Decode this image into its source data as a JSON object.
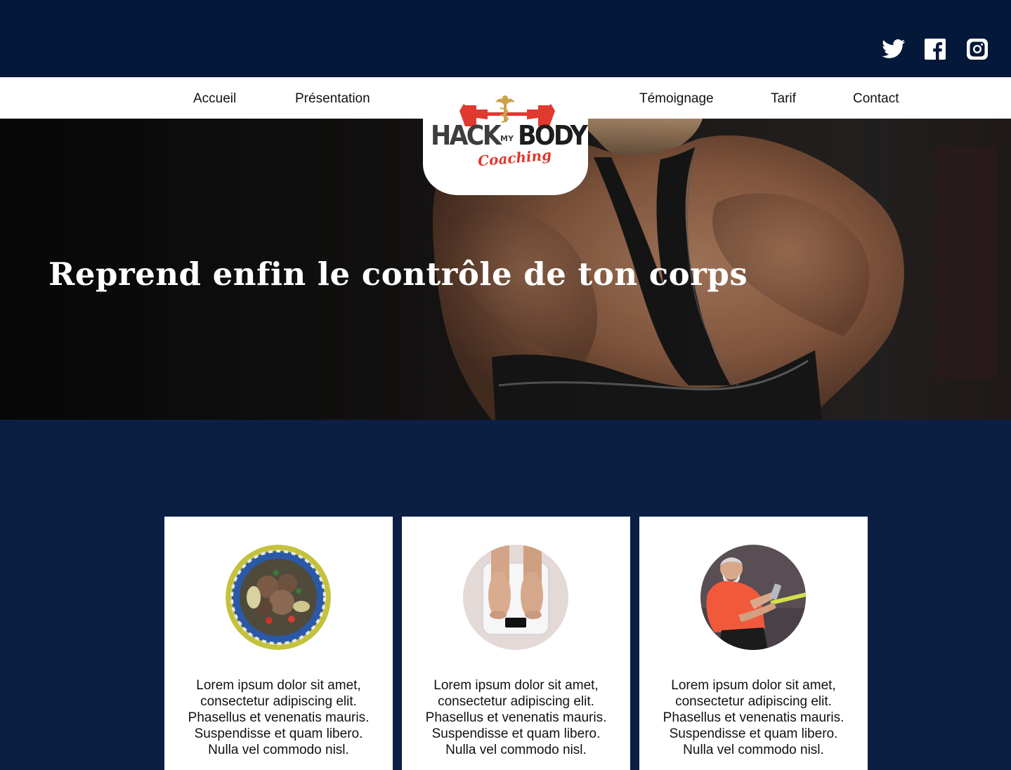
{
  "social": {
    "twitter": "twitter-icon",
    "facebook": "facebook-icon",
    "instagram": "instagram-icon"
  },
  "nav": {
    "items": [
      {
        "label": "Accueil"
      },
      {
        "label": "Présentation"
      },
      {
        "label": "Témoignage"
      },
      {
        "label": "Tarif"
      },
      {
        "label": "Contact"
      }
    ]
  },
  "logo": {
    "hack": "HACK",
    "my": "MY",
    "body": "BODY",
    "coaching": "Coaching"
  },
  "hero": {
    "title": "Reprend enfin le contrôle de ton corps"
  },
  "cards": [
    {
      "image": "salad-bowl-photo",
      "lines": [
        "Lorem ipsum dolor sit amet,",
        "consectetur adipiscing elit.",
        "Phasellus et venenatis mauris.",
        "Suspendisse et quam libero.",
        "Nulla vel commodo nisl."
      ]
    },
    {
      "image": "bathroom-scale-photo",
      "lines": [
        "Lorem ipsum dolor sit amet,",
        "consectetur adipiscing elit.",
        "Phasellus et venenatis mauris.",
        "Suspendisse et quam libero.",
        "Nulla vel commodo nisl."
      ]
    },
    {
      "image": "runner-with-phone-photo",
      "lines": [
        "Lorem ipsum dolor sit amet,",
        "consectetur adipiscing elit.",
        "Phasellus et venenatis mauris.",
        "Suspendisse et quam libero.",
        "Nulla vel commodo nisl."
      ]
    }
  ],
  "colors": {
    "topbar": "#04183a",
    "page_background": "#0b1f42",
    "nav_background": "#ffffff",
    "logo_red": "#e0392f",
    "logo_gray": "#3d3d3d"
  }
}
